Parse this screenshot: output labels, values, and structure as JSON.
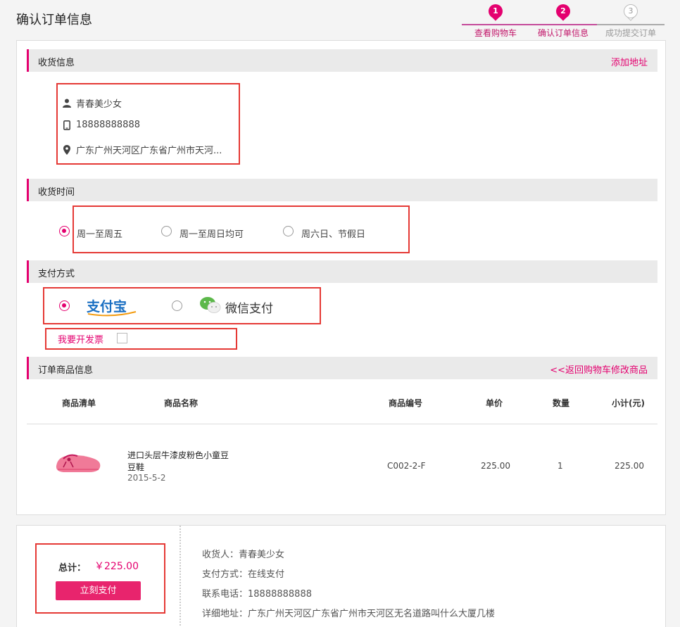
{
  "page": {
    "title": "确认订单信息"
  },
  "steps": [
    {
      "num": "1",
      "label": "查看购物车",
      "state": "active"
    },
    {
      "num": "2",
      "label": "确认订单信息",
      "state": "active"
    },
    {
      "num": "3",
      "label": "成功提交订单",
      "state": "inactive"
    }
  ],
  "shipping": {
    "title": "收货信息",
    "add_link": "添加地址",
    "name": "青春美少女",
    "phone": "18888888888",
    "address": "广东广州天河区广东省广州市天河..."
  },
  "delivery_time": {
    "title": "收货时间",
    "options": [
      "周一至周五",
      "周一至周日均可",
      "周六日、节假日"
    ],
    "selected": 0
  },
  "payment": {
    "title": "支付方式",
    "alipay_logo_text": "支付宝",
    "wechat_label": "微信支付",
    "selected": "alipay",
    "invoice_label": "我要开发票"
  },
  "order_items": {
    "title": "订单商品信息",
    "back_link": "<<返回购物车修改商品",
    "headers": [
      "商品清单",
      "商品名称",
      "商品编号",
      "单价",
      "数量",
      "小计(元)"
    ],
    "rows": [
      {
        "name_line1": "进口头层牛漆皮粉色小童豆",
        "name_line2": "豆鞋",
        "date": "2015-5-2",
        "sku": "C002-2-F",
        "price": "225.00",
        "qty": "1",
        "subtotal": "225.00"
      }
    ]
  },
  "summary": {
    "total_label": "总计：",
    "total_value": "￥225.00",
    "pay_button": "立刻支付",
    "receiver": "收货人：青春美少女",
    "pay_method": "支付方式：在线支付",
    "phone": "联系电话：18888888888",
    "address": "详细地址：广东广州天河区广东省广州市天河区无名道路叫什么大厦几楼"
  },
  "colors": {
    "accent": "#e4006f",
    "highlight_box": "#e53935",
    "button": "#e8246d"
  }
}
